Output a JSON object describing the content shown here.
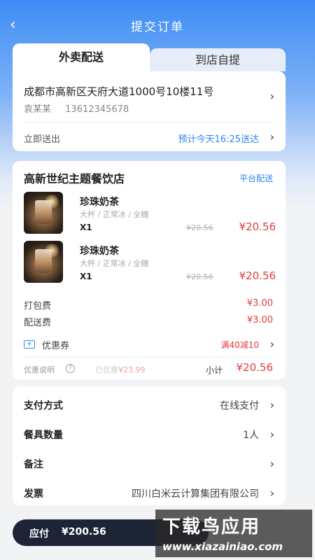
{
  "header": {
    "title": "提交订单",
    "back_icon": "chevron-left-icon"
  },
  "tabs": [
    {
      "label": "外卖配送",
      "active": true
    },
    {
      "label": "到店自提",
      "active": false
    }
  ],
  "address": {
    "line": "成都市高新区天府大道1000号10楼11号",
    "name": "袁某某",
    "phone": "13612345678",
    "deliver_label": "立即送出",
    "eta": "预计今天16:25送达"
  },
  "store": {
    "name": "高新世纪主题餐饮店",
    "badge": "平台配送",
    "items": [
      {
        "name": "珍珠奶茶",
        "spec": "大杯 / 正常冰 / 全糖",
        "qty": "X1",
        "orig_price": "¥20.56",
        "price": "¥20.56"
      },
      {
        "name": "珍珠奶茶",
        "spec": "大杯 / 正常冰 / 全糖",
        "qty": "X1",
        "orig_price": "¥20.56",
        "price": "¥20.56"
      }
    ],
    "packing_label": "打包费",
    "packing_fee": "¥3.00",
    "delivery_label": "配送费",
    "delivery_fee": "¥3.00",
    "coupon_label": "优惠券",
    "coupon_value": "满40减10",
    "discount_label": "优惠说明",
    "discounted_prefix": "已优惠",
    "discounted_amount": "¥23.99",
    "subtotal_label": "小计",
    "subtotal": "¥20.56"
  },
  "options": [
    {
      "label": "支付方式",
      "value": "在线支付"
    },
    {
      "label": "餐具数量",
      "value": "1人"
    },
    {
      "label": "备注",
      "value": ""
    },
    {
      "label": "发票",
      "value": "四川白米云计算集团有限公司"
    }
  ],
  "pay": {
    "label": "应付",
    "amount": "¥200.56"
  },
  "watermark": {
    "main": "下载鸟应用",
    "url": "www.xiazainiao.com"
  },
  "colors": {
    "accent": "#2f86ee",
    "price": "#e43b3b",
    "pay_bar": "#1c2436"
  }
}
